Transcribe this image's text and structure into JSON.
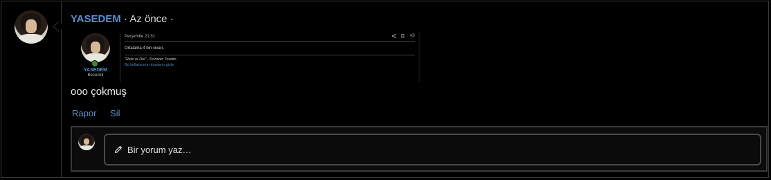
{
  "post": {
    "username": "YASEDEM",
    "separator1": " · ",
    "time": "Az önce",
    "separator2": " ·",
    "comment_text": "ooo çokmuş"
  },
  "embedded_screenshot": {
    "username": "YASEDEM",
    "rank": "Becerikli",
    "date": "Perşembe 21:31",
    "post_number": "#3",
    "body": "Ortalama 4 bin civarı.",
    "signature": "\"Ride or Die\" - Dominic Toretto",
    "hide_signature": "Bu kullanıcının imzasını gizle",
    "icons": [
      "share-icon",
      "bookmark-icon"
    ]
  },
  "actions": {
    "report": "Rapor",
    "delete": "Sil"
  },
  "reply": {
    "placeholder": "Bir yorum yaz…",
    "icon": "pencil-icon"
  },
  "colors": {
    "accent": "#5b8fc9",
    "background": "#000000",
    "border": "#3a3a3a"
  }
}
